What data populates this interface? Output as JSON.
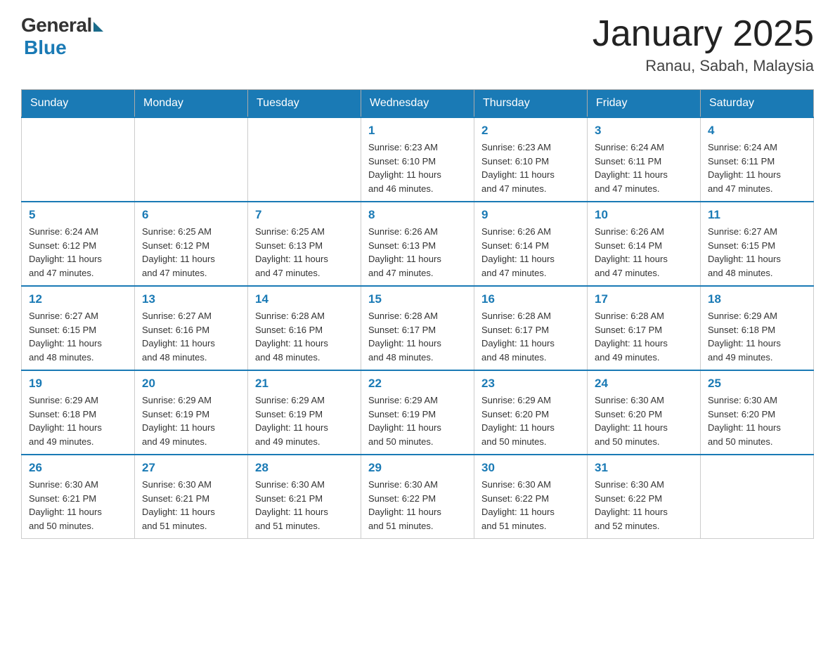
{
  "header": {
    "logo": {
      "general": "General",
      "blue": "Blue"
    },
    "title": "January 2025",
    "location": "Ranau, Sabah, Malaysia"
  },
  "weekdays": [
    "Sunday",
    "Monday",
    "Tuesday",
    "Wednesday",
    "Thursday",
    "Friday",
    "Saturday"
  ],
  "weeks": [
    [
      {
        "day": null,
        "info": null
      },
      {
        "day": null,
        "info": null
      },
      {
        "day": null,
        "info": null
      },
      {
        "day": "1",
        "info": "Sunrise: 6:23 AM\nSunset: 6:10 PM\nDaylight: 11 hours\nand 46 minutes."
      },
      {
        "day": "2",
        "info": "Sunrise: 6:23 AM\nSunset: 6:10 PM\nDaylight: 11 hours\nand 47 minutes."
      },
      {
        "day": "3",
        "info": "Sunrise: 6:24 AM\nSunset: 6:11 PM\nDaylight: 11 hours\nand 47 minutes."
      },
      {
        "day": "4",
        "info": "Sunrise: 6:24 AM\nSunset: 6:11 PM\nDaylight: 11 hours\nand 47 minutes."
      }
    ],
    [
      {
        "day": "5",
        "info": "Sunrise: 6:24 AM\nSunset: 6:12 PM\nDaylight: 11 hours\nand 47 minutes."
      },
      {
        "day": "6",
        "info": "Sunrise: 6:25 AM\nSunset: 6:12 PM\nDaylight: 11 hours\nand 47 minutes."
      },
      {
        "day": "7",
        "info": "Sunrise: 6:25 AM\nSunset: 6:13 PM\nDaylight: 11 hours\nand 47 minutes."
      },
      {
        "day": "8",
        "info": "Sunrise: 6:26 AM\nSunset: 6:13 PM\nDaylight: 11 hours\nand 47 minutes."
      },
      {
        "day": "9",
        "info": "Sunrise: 6:26 AM\nSunset: 6:14 PM\nDaylight: 11 hours\nand 47 minutes."
      },
      {
        "day": "10",
        "info": "Sunrise: 6:26 AM\nSunset: 6:14 PM\nDaylight: 11 hours\nand 47 minutes."
      },
      {
        "day": "11",
        "info": "Sunrise: 6:27 AM\nSunset: 6:15 PM\nDaylight: 11 hours\nand 48 minutes."
      }
    ],
    [
      {
        "day": "12",
        "info": "Sunrise: 6:27 AM\nSunset: 6:15 PM\nDaylight: 11 hours\nand 48 minutes."
      },
      {
        "day": "13",
        "info": "Sunrise: 6:27 AM\nSunset: 6:16 PM\nDaylight: 11 hours\nand 48 minutes."
      },
      {
        "day": "14",
        "info": "Sunrise: 6:28 AM\nSunset: 6:16 PM\nDaylight: 11 hours\nand 48 minutes."
      },
      {
        "day": "15",
        "info": "Sunrise: 6:28 AM\nSunset: 6:17 PM\nDaylight: 11 hours\nand 48 minutes."
      },
      {
        "day": "16",
        "info": "Sunrise: 6:28 AM\nSunset: 6:17 PM\nDaylight: 11 hours\nand 48 minutes."
      },
      {
        "day": "17",
        "info": "Sunrise: 6:28 AM\nSunset: 6:17 PM\nDaylight: 11 hours\nand 49 minutes."
      },
      {
        "day": "18",
        "info": "Sunrise: 6:29 AM\nSunset: 6:18 PM\nDaylight: 11 hours\nand 49 minutes."
      }
    ],
    [
      {
        "day": "19",
        "info": "Sunrise: 6:29 AM\nSunset: 6:18 PM\nDaylight: 11 hours\nand 49 minutes."
      },
      {
        "day": "20",
        "info": "Sunrise: 6:29 AM\nSunset: 6:19 PM\nDaylight: 11 hours\nand 49 minutes."
      },
      {
        "day": "21",
        "info": "Sunrise: 6:29 AM\nSunset: 6:19 PM\nDaylight: 11 hours\nand 49 minutes."
      },
      {
        "day": "22",
        "info": "Sunrise: 6:29 AM\nSunset: 6:19 PM\nDaylight: 11 hours\nand 50 minutes."
      },
      {
        "day": "23",
        "info": "Sunrise: 6:29 AM\nSunset: 6:20 PM\nDaylight: 11 hours\nand 50 minutes."
      },
      {
        "day": "24",
        "info": "Sunrise: 6:30 AM\nSunset: 6:20 PM\nDaylight: 11 hours\nand 50 minutes."
      },
      {
        "day": "25",
        "info": "Sunrise: 6:30 AM\nSunset: 6:20 PM\nDaylight: 11 hours\nand 50 minutes."
      }
    ],
    [
      {
        "day": "26",
        "info": "Sunrise: 6:30 AM\nSunset: 6:21 PM\nDaylight: 11 hours\nand 50 minutes."
      },
      {
        "day": "27",
        "info": "Sunrise: 6:30 AM\nSunset: 6:21 PM\nDaylight: 11 hours\nand 51 minutes."
      },
      {
        "day": "28",
        "info": "Sunrise: 6:30 AM\nSunset: 6:21 PM\nDaylight: 11 hours\nand 51 minutes."
      },
      {
        "day": "29",
        "info": "Sunrise: 6:30 AM\nSunset: 6:22 PM\nDaylight: 11 hours\nand 51 minutes."
      },
      {
        "day": "30",
        "info": "Sunrise: 6:30 AM\nSunset: 6:22 PM\nDaylight: 11 hours\nand 51 minutes."
      },
      {
        "day": "31",
        "info": "Sunrise: 6:30 AM\nSunset: 6:22 PM\nDaylight: 11 hours\nand 52 minutes."
      },
      {
        "day": null,
        "info": null
      }
    ]
  ]
}
